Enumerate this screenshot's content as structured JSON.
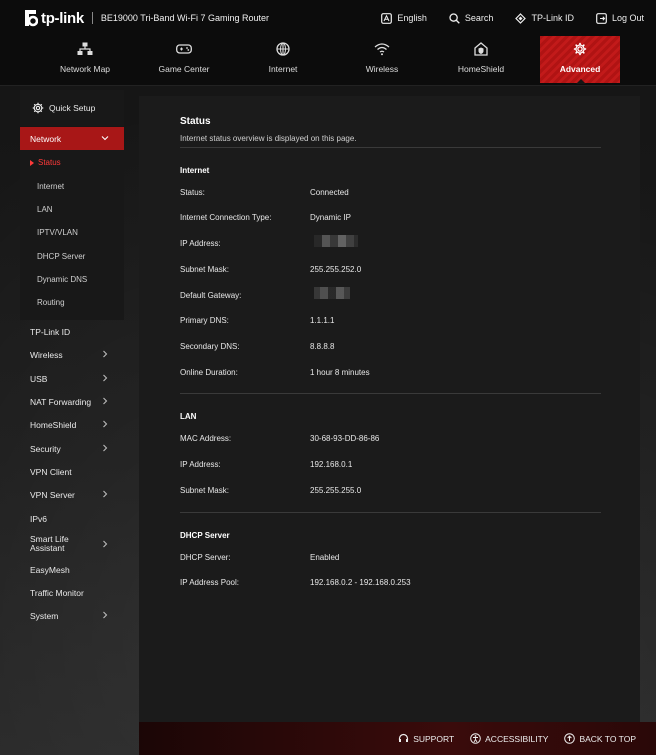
{
  "topbar": {
    "logo_text": "tp-link",
    "product": "BE19000 Tri-Band Wi-Fi 7 Gaming Router",
    "links": {
      "language": "English",
      "search": "Search",
      "tplink_id": "TP-Link ID",
      "logout": "Log Out"
    }
  },
  "nav": {
    "tabs": {
      "network_map": "Network Map",
      "game_center": "Game Center",
      "internet": "Internet",
      "wireless": "Wireless",
      "homeshield": "HomeShield",
      "advanced": "Advanced"
    },
    "active": "Advanced"
  },
  "sidebar": {
    "quick_setup": "Quick Setup",
    "network": "Network",
    "network_sub": {
      "status": "Status",
      "internet": "Internet",
      "lan": "LAN",
      "iptv": "IPTV/VLAN",
      "dhcp": "DHCP Server",
      "ddns": "Dynamic DNS",
      "routing": "Routing"
    },
    "tplink_id": "TP-Link ID",
    "wireless": "Wireless",
    "usb": "USB",
    "nat": "NAT Forwarding",
    "homeshield": "HomeShield",
    "security": "Security",
    "vpn_client": "VPN Client",
    "vpn_server": "VPN Server",
    "ipv6": "IPv6",
    "smart_life_1": "Smart Life",
    "smart_life_2": "Assistant",
    "easymesh": "EasyMesh",
    "traffic": "Traffic Monitor",
    "system": "System"
  },
  "status": {
    "title": "Status",
    "description": "Internet status overview is displayed on this page.",
    "internet": {
      "heading": "Internet",
      "status_label": "Status:",
      "status_value": "Connected",
      "conn_type_label": "Internet Connection Type:",
      "conn_type_value": "Dynamic IP",
      "ip_label": "IP Address:",
      "subnet_label": "Subnet Mask:",
      "subnet_value": "255.255.252.0",
      "gateway_label": "Default Gateway:",
      "pdns_label": "Primary DNS:",
      "pdns_value": "1.1.1.1",
      "sdns_label": "Secondary DNS:",
      "sdns_value": "8.8.8.8",
      "duration_label": "Online Duration:",
      "duration_value": "1 hour 8 minutes"
    },
    "lan": {
      "heading": "LAN",
      "mac_label": "MAC Address:",
      "mac_value": "30-68-93-DD-86-86",
      "ip_label": "IP Address:",
      "ip_value": "192.168.0.1",
      "subnet_label": "Subnet Mask:",
      "subnet_value": "255.255.255.0"
    },
    "dhcp": {
      "heading": "DHCP Server",
      "server_label": "DHCP Server:",
      "server_value": "Enabled",
      "pool_label": "IP Address Pool:",
      "pool_value": "192.168.0.2 - 192.168.0.253"
    }
  },
  "footer": {
    "support": "SUPPORT",
    "accessibility": "ACCESSIBILITY",
    "back_to_top": "BACK TO TOP"
  },
  "colors": {
    "accent": "#a81717",
    "active_sub": "#ff3a3a"
  }
}
